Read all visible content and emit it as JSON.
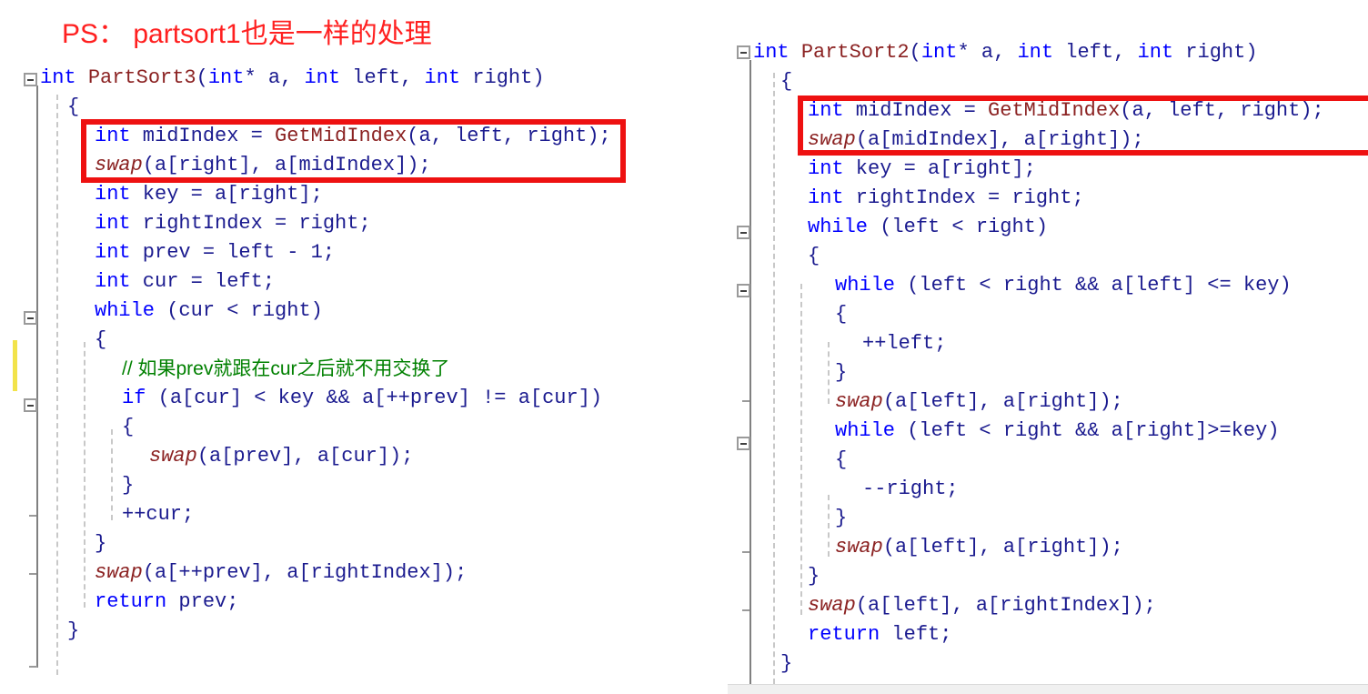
{
  "note": {
    "text": "PS： partsort1也是一样的处理",
    "color": "#ff2020"
  },
  "colors": {
    "keyword": "#0000ff",
    "function": "#8b2222",
    "identifier": "#1b1b8f",
    "comment": "#008000",
    "highlight_box": "#ee1111",
    "change_bar": "#f2e34a",
    "gutter": "#9a9a9a"
  },
  "left_panel": {
    "function_name": "PartSort3",
    "highlight_label": "red-highlight-box-left",
    "lines": [
      {
        "indent": 0,
        "tokens": [
          [
            "kw",
            "int"
          ],
          [
            "id",
            " "
          ],
          [
            "fn",
            "PartSort3"
          ],
          [
            "pn",
            "("
          ],
          [
            "kw",
            "int"
          ],
          [
            "pn",
            "* "
          ],
          [
            "id",
            "a"
          ],
          [
            "pn",
            ", "
          ],
          [
            "kw",
            "int"
          ],
          [
            "id",
            " left"
          ],
          [
            "pn",
            ", "
          ],
          [
            "kw",
            "int"
          ],
          [
            "id",
            " right"
          ],
          [
            "pn",
            ")"
          ]
        ]
      },
      {
        "indent": 1,
        "tokens": [
          [
            "pn",
            "{"
          ]
        ]
      },
      {
        "indent": 2,
        "tokens": [
          [
            "kw",
            "int"
          ],
          [
            "id",
            " midIndex "
          ],
          [
            "pn",
            "= "
          ],
          [
            "fn",
            "GetMidIndex"
          ],
          [
            "pn",
            "("
          ],
          [
            "id",
            "a"
          ],
          [
            "pn",
            ", "
          ],
          [
            "id",
            "left"
          ],
          [
            "pn",
            ", "
          ],
          [
            "id",
            "right"
          ],
          [
            "pn",
            ");"
          ]
        ]
      },
      {
        "indent": 2,
        "tokens": [
          [
            "sw",
            "swap"
          ],
          [
            "pn",
            "("
          ],
          [
            "id",
            "a"
          ],
          [
            "pn",
            "["
          ],
          [
            "id",
            "right"
          ],
          [
            "pn",
            "], "
          ],
          [
            "id",
            "a"
          ],
          [
            "pn",
            "["
          ],
          [
            "id",
            "midIndex"
          ],
          [
            "pn",
            "]);"
          ]
        ]
      },
      {
        "indent": 2,
        "tokens": [
          [
            "kw",
            "int"
          ],
          [
            "id",
            " key "
          ],
          [
            "pn",
            "= "
          ],
          [
            "id",
            "a"
          ],
          [
            "pn",
            "["
          ],
          [
            "id",
            "right"
          ],
          [
            "pn",
            "];"
          ]
        ]
      },
      {
        "indent": 2,
        "tokens": [
          [
            "kw",
            "int"
          ],
          [
            "id",
            " rightIndex "
          ],
          [
            "pn",
            "= "
          ],
          [
            "id",
            "right"
          ],
          [
            "pn",
            ";"
          ]
        ]
      },
      {
        "indent": 2,
        "tokens": [
          [
            "kw",
            "int"
          ],
          [
            "id",
            " prev "
          ],
          [
            "pn",
            "= "
          ],
          [
            "id",
            "left"
          ],
          [
            "pn",
            " - "
          ],
          [
            "id",
            "1"
          ],
          [
            "pn",
            ";"
          ]
        ]
      },
      {
        "indent": 2,
        "tokens": [
          [
            "kw",
            "int"
          ],
          [
            "id",
            " cur "
          ],
          [
            "pn",
            "= "
          ],
          [
            "id",
            "left"
          ],
          [
            "pn",
            ";"
          ]
        ]
      },
      {
        "indent": 2,
        "tokens": [
          [
            "kw",
            "while"
          ],
          [
            "pn",
            " ("
          ],
          [
            "id",
            "cur"
          ],
          [
            "pn",
            " < "
          ],
          [
            "id",
            "right"
          ],
          [
            "pn",
            ")"
          ]
        ]
      },
      {
        "indent": 2,
        "tokens": [
          [
            "pn",
            "{"
          ]
        ]
      },
      {
        "indent": 3,
        "comment_cn": "// 如果prev就跟在cur之后就不用交换了"
      },
      {
        "indent": 3,
        "tokens": [
          [
            "kw",
            "if"
          ],
          [
            "pn",
            " ("
          ],
          [
            "id",
            "a"
          ],
          [
            "pn",
            "["
          ],
          [
            "id",
            "cur"
          ],
          [
            "pn",
            "] < "
          ],
          [
            "id",
            "key"
          ],
          [
            "pn",
            " && "
          ],
          [
            "id",
            "a"
          ],
          [
            "pn",
            "[++"
          ],
          [
            "id",
            "prev"
          ],
          [
            "pn",
            "] != "
          ],
          [
            "id",
            "a"
          ],
          [
            "pn",
            "["
          ],
          [
            "id",
            "cur"
          ],
          [
            "pn",
            "])"
          ]
        ]
      },
      {
        "indent": 3,
        "tokens": [
          [
            "pn",
            "{"
          ]
        ]
      },
      {
        "indent": 4,
        "tokens": [
          [
            "sw",
            "swap"
          ],
          [
            "pn",
            "("
          ],
          [
            "id",
            "a"
          ],
          [
            "pn",
            "["
          ],
          [
            "id",
            "prev"
          ],
          [
            "pn",
            "], "
          ],
          [
            "id",
            "a"
          ],
          [
            "pn",
            "["
          ],
          [
            "id",
            "cur"
          ],
          [
            "pn",
            "]);"
          ]
        ]
      },
      {
        "indent": 3,
        "tokens": [
          [
            "pn",
            "}"
          ]
        ]
      },
      {
        "indent": 3,
        "tokens": [
          [
            "pn",
            "++"
          ],
          [
            "id",
            "cur"
          ],
          [
            "pn",
            ";"
          ]
        ]
      },
      {
        "indent": 2,
        "tokens": [
          [
            "pn",
            "}"
          ]
        ]
      },
      {
        "indent": 2,
        "tokens": [
          [
            "sw",
            "swap"
          ],
          [
            "pn",
            "("
          ],
          [
            "id",
            "a"
          ],
          [
            "pn",
            "[++"
          ],
          [
            "id",
            "prev"
          ],
          [
            "pn",
            "], "
          ],
          [
            "id",
            "a"
          ],
          [
            "pn",
            "["
          ],
          [
            "id",
            "rightIndex"
          ],
          [
            "pn",
            "]);"
          ]
        ]
      },
      {
        "indent": 2,
        "tokens": [
          [
            "kw",
            "return"
          ],
          [
            "id",
            " prev"
          ],
          [
            "pn",
            ";"
          ]
        ]
      },
      {
        "indent": 1,
        "tokens": [
          [
            "pn",
            "}"
          ]
        ]
      }
    ]
  },
  "right_panel": {
    "function_name": "PartSort2",
    "highlight_label": "red-highlight-box-right",
    "lines": [
      {
        "indent": 0,
        "tokens": [
          [
            "kw",
            "int"
          ],
          [
            "id",
            " "
          ],
          [
            "fn",
            "PartSort2"
          ],
          [
            "pn",
            "("
          ],
          [
            "kw",
            "int"
          ],
          [
            "pn",
            "* "
          ],
          [
            "id",
            "a"
          ],
          [
            "pn",
            ", "
          ],
          [
            "kw",
            "int"
          ],
          [
            "id",
            " left"
          ],
          [
            "pn",
            ", "
          ],
          [
            "kw",
            "int"
          ],
          [
            "id",
            " right"
          ],
          [
            "pn",
            ")"
          ]
        ]
      },
      {
        "indent": 1,
        "tokens": [
          [
            "pn",
            "{"
          ]
        ]
      },
      {
        "indent": 2,
        "tokens": [
          [
            "kw",
            "int"
          ],
          [
            "id",
            " midIndex "
          ],
          [
            "pn",
            "= "
          ],
          [
            "fn",
            "GetMidIndex"
          ],
          [
            "pn",
            "("
          ],
          [
            "id",
            "a"
          ],
          [
            "pn",
            ", "
          ],
          [
            "id",
            "left"
          ],
          [
            "pn",
            ", "
          ],
          [
            "id",
            "right"
          ],
          [
            "pn",
            ");"
          ]
        ]
      },
      {
        "indent": 2,
        "tokens": [
          [
            "sw",
            "swap"
          ],
          [
            "pn",
            "("
          ],
          [
            "id",
            "a"
          ],
          [
            "pn",
            "["
          ],
          [
            "id",
            "midIndex"
          ],
          [
            "pn",
            "], "
          ],
          [
            "id",
            "a"
          ],
          [
            "pn",
            "["
          ],
          [
            "id",
            "right"
          ],
          [
            "pn",
            "]);"
          ]
        ]
      },
      {
        "indent": 2,
        "tokens": [
          [
            "kw",
            "int"
          ],
          [
            "id",
            " key "
          ],
          [
            "pn",
            "= "
          ],
          [
            "id",
            "a"
          ],
          [
            "pn",
            "["
          ],
          [
            "id",
            "right"
          ],
          [
            "pn",
            "];"
          ]
        ]
      },
      {
        "indent": 2,
        "tokens": [
          [
            "kw",
            "int"
          ],
          [
            "id",
            " rightIndex "
          ],
          [
            "pn",
            "= "
          ],
          [
            "id",
            "right"
          ],
          [
            "pn",
            ";"
          ]
        ]
      },
      {
        "indent": 2,
        "tokens": [
          [
            "kw",
            "while"
          ],
          [
            "pn",
            " ("
          ],
          [
            "id",
            "left"
          ],
          [
            "pn",
            " < "
          ],
          [
            "id",
            "right"
          ],
          [
            "pn",
            ")"
          ]
        ]
      },
      {
        "indent": 2,
        "tokens": [
          [
            "pn",
            "{"
          ]
        ]
      },
      {
        "indent": 3,
        "tokens": [
          [
            "kw",
            "while"
          ],
          [
            "pn",
            " ("
          ],
          [
            "id",
            "left"
          ],
          [
            "pn",
            " < "
          ],
          [
            "id",
            "right"
          ],
          [
            "pn",
            " && "
          ],
          [
            "id",
            "a"
          ],
          [
            "pn",
            "["
          ],
          [
            "id",
            "left"
          ],
          [
            "pn",
            "] <= "
          ],
          [
            "id",
            "key"
          ],
          [
            "pn",
            ")"
          ]
        ]
      },
      {
        "indent": 3,
        "tokens": [
          [
            "pn",
            "{"
          ]
        ]
      },
      {
        "indent": 4,
        "tokens": [
          [
            "pn",
            "++"
          ],
          [
            "id",
            "left"
          ],
          [
            "pn",
            ";"
          ]
        ]
      },
      {
        "indent": 3,
        "tokens": [
          [
            "pn",
            "}"
          ]
        ]
      },
      {
        "indent": 3,
        "tokens": [
          [
            "sw",
            "swap"
          ],
          [
            "pn",
            "("
          ],
          [
            "id",
            "a"
          ],
          [
            "pn",
            "["
          ],
          [
            "id",
            "left"
          ],
          [
            "pn",
            "], "
          ],
          [
            "id",
            "a"
          ],
          [
            "pn",
            "["
          ],
          [
            "id",
            "right"
          ],
          [
            "pn",
            "]);"
          ]
        ]
      },
      {
        "indent": 3,
        "tokens": [
          [
            "kw",
            "while"
          ],
          [
            "pn",
            " ("
          ],
          [
            "id",
            "left"
          ],
          [
            "pn",
            " < "
          ],
          [
            "id",
            "right"
          ],
          [
            "pn",
            " && "
          ],
          [
            "id",
            "a"
          ],
          [
            "pn",
            "["
          ],
          [
            "id",
            "right"
          ],
          [
            "pn",
            "]>="
          ],
          [
            "id",
            "key"
          ],
          [
            "pn",
            ")"
          ]
        ]
      },
      {
        "indent": 3,
        "tokens": [
          [
            "pn",
            "{"
          ]
        ]
      },
      {
        "indent": 4,
        "tokens": [
          [
            "pn",
            "--"
          ],
          [
            "id",
            "right"
          ],
          [
            "pn",
            ";"
          ]
        ]
      },
      {
        "indent": 3,
        "tokens": [
          [
            "pn",
            "}"
          ]
        ]
      },
      {
        "indent": 3,
        "tokens": [
          [
            "sw",
            "swap"
          ],
          [
            "pn",
            "("
          ],
          [
            "id",
            "a"
          ],
          [
            "pn",
            "["
          ],
          [
            "id",
            "left"
          ],
          [
            "pn",
            "], "
          ],
          [
            "id",
            "a"
          ],
          [
            "pn",
            "["
          ],
          [
            "id",
            "right"
          ],
          [
            "pn",
            "]);"
          ]
        ]
      },
      {
        "indent": 2,
        "tokens": [
          [
            "pn",
            "}"
          ]
        ]
      },
      {
        "indent": 2,
        "tokens": [
          [
            "sw",
            "swap"
          ],
          [
            "pn",
            "("
          ],
          [
            "id",
            "a"
          ],
          [
            "pn",
            "["
          ],
          [
            "id",
            "left"
          ],
          [
            "pn",
            "], "
          ],
          [
            "id",
            "a"
          ],
          [
            "pn",
            "["
          ],
          [
            "id",
            "rightIndex"
          ],
          [
            "pn",
            "]);"
          ]
        ]
      },
      {
        "indent": 2,
        "tokens": [
          [
            "kw",
            "return"
          ],
          [
            "id",
            " left"
          ],
          [
            "pn",
            ";"
          ]
        ]
      },
      {
        "indent": 1,
        "tokens": [
          [
            "pn",
            "}"
          ]
        ]
      }
    ]
  }
}
